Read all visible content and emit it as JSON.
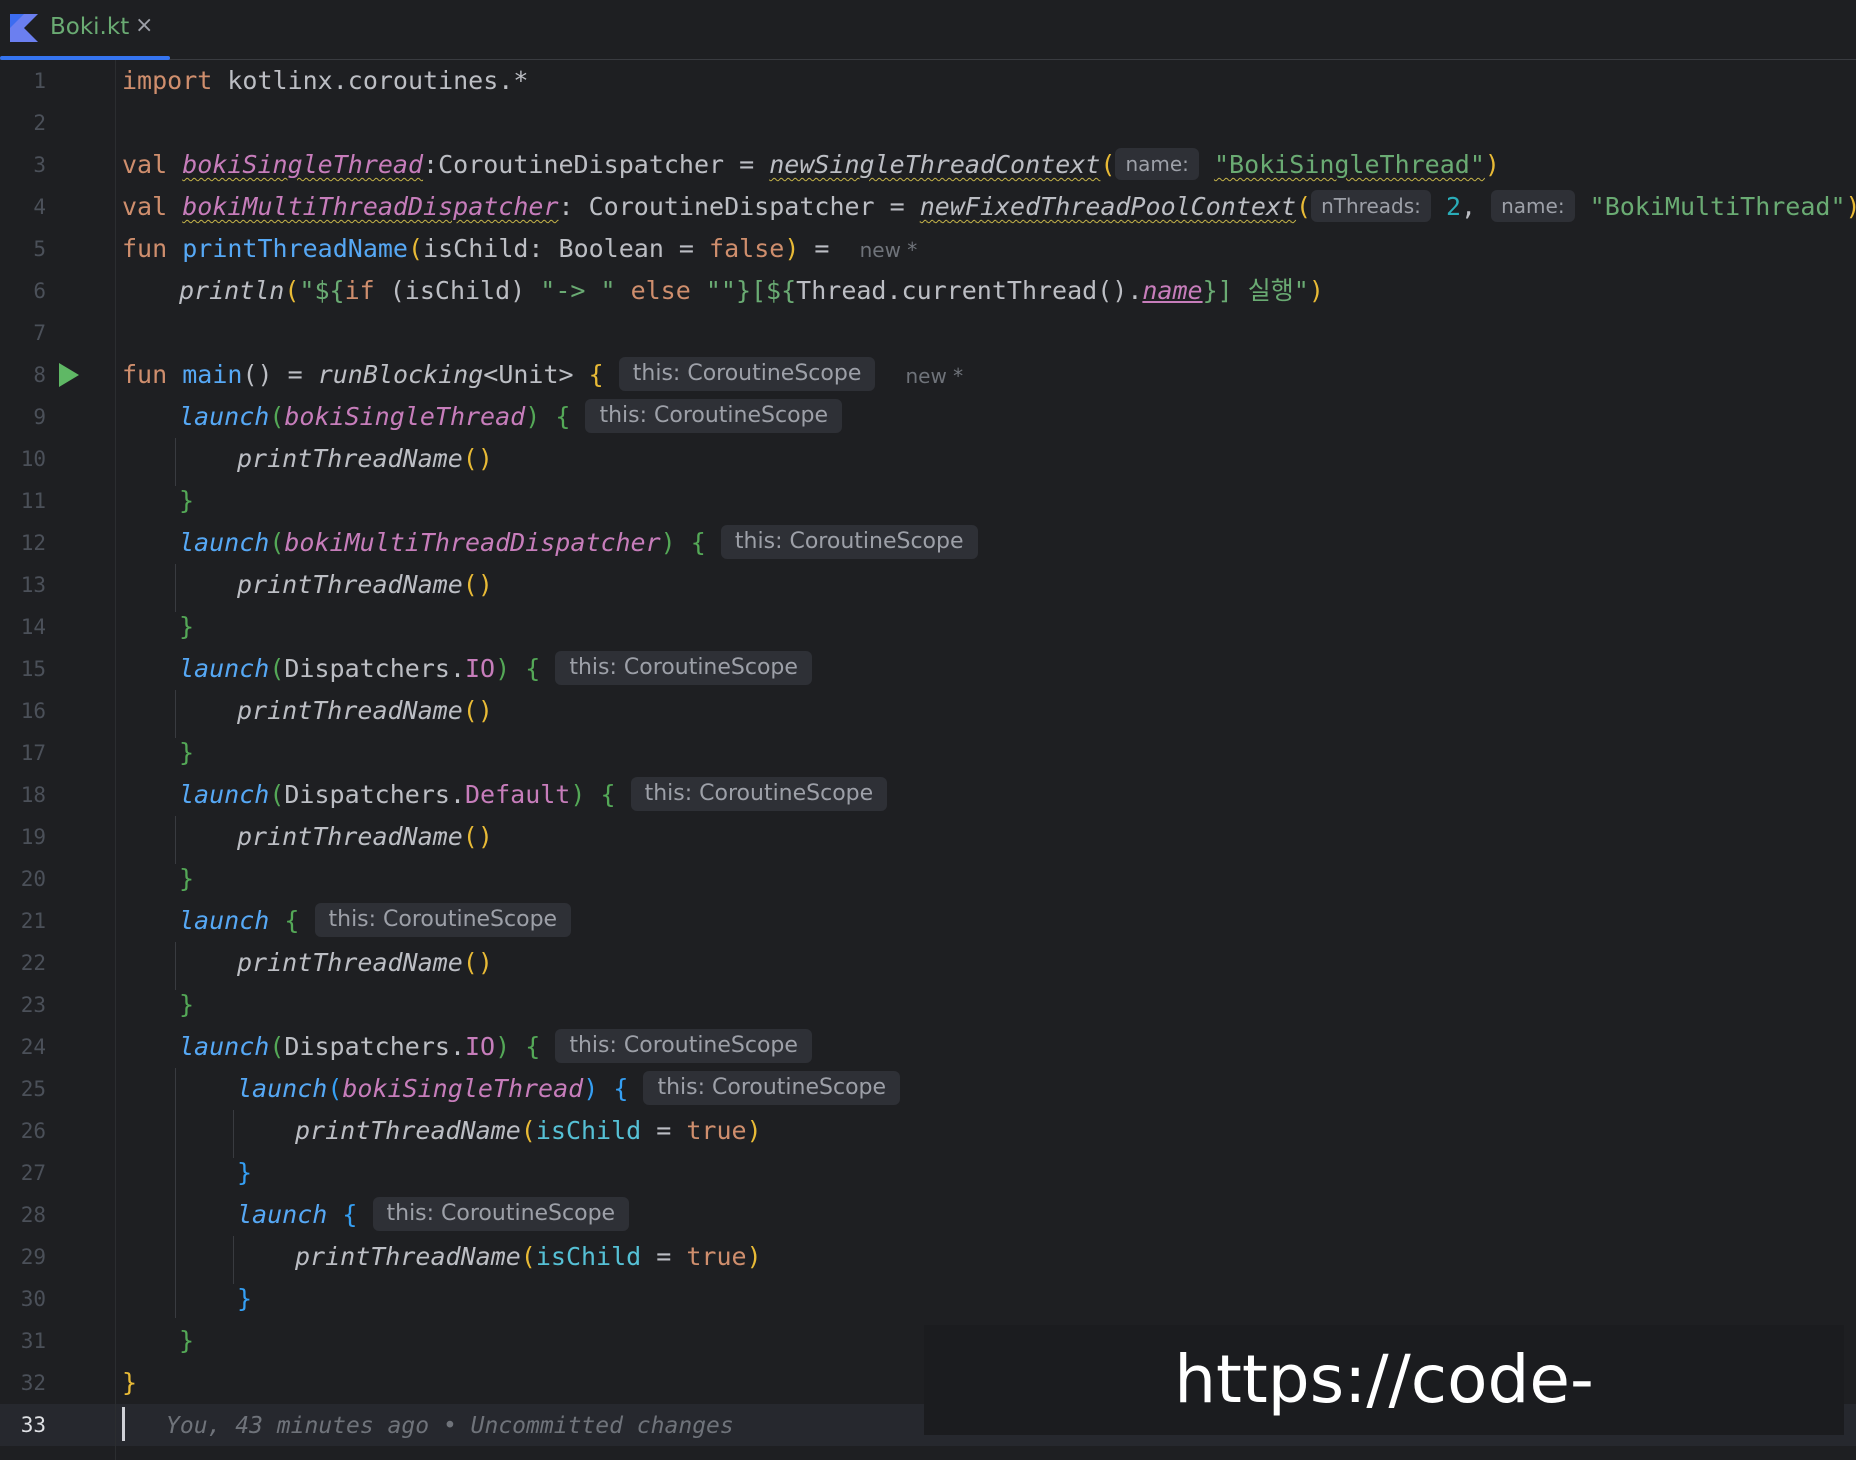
{
  "tab": {
    "label": "Boki.kt",
    "close": "×",
    "icon": "kotlin-file-icon"
  },
  "line_numbers": [
    "1",
    "2",
    "3",
    "4",
    "5",
    "6",
    "7",
    "8",
    "9",
    "10",
    "11",
    "12",
    "13",
    "14",
    "15",
    "16",
    "17",
    "18",
    "19",
    "20",
    "21",
    "22",
    "23",
    "24",
    "25",
    "26",
    "27",
    "28",
    "29",
    "30",
    "31",
    "32",
    "33"
  ],
  "current_line": "33",
  "hints": {
    "scope": "this: CoroutineScope",
    "name": "name:",
    "n_threads": "nThreads:",
    "new_marker": "new *"
  },
  "code": {
    "l1_kw": "import",
    "l1_rest": " kotlinx.coroutines.*",
    "l3_kw": "val",
    "l3_prop": "bokiSingleThread",
    "l3_type": ":CoroutineDispatcher = ",
    "l3_fn": "newSingleThreadContext",
    "l3_str": "\"BokiSingleThread\"",
    "l4_kw": "val",
    "l4_prop": "bokiMultiThreadDispatcher",
    "l4_type": ": CoroutineDispatcher = ",
    "l4_fn": "newFixedThreadPoolContext",
    "l4_num": "2",
    "l4_str": "\"BokiMultiThread\"",
    "l5_kw": "fun",
    "l5_fn": "printThreadName",
    "l5_param": "isChild: Boolean = ",
    "l5_false": "false",
    "l5_eq": " = ",
    "l6_call": "println",
    "l6_a": "\"${",
    "l6_if": "if",
    "l6_b": " (isChild) ",
    "l6_c": "\"-> \"",
    "l6_else": " else ",
    "l6_d": "\"\"",
    "l6_e": "}[${",
    "l6_f": "Thread.currentThread()",
    "l6_name": "name",
    "l6_g": "}] 실행\"",
    "l8_kw": "fun",
    "l8_fn": "main",
    "l8_rest": "() = ",
    "l8_call": "runBlocking",
    "l8_gen": "<Unit>",
    "launch": "launch",
    "print_call": "printThreadName",
    "single": "bokiSingleThread",
    "multi": "bokiMultiThreadDispatcher",
    "dispatchers": "Dispatchers.",
    "io": "IO",
    "default": "Default",
    "is_child": "isChild",
    "true": "true"
  },
  "blame": "You, 43 minutes ago • Uncommitted changes",
  "watermark": "https://code-boki.tistory.com"
}
